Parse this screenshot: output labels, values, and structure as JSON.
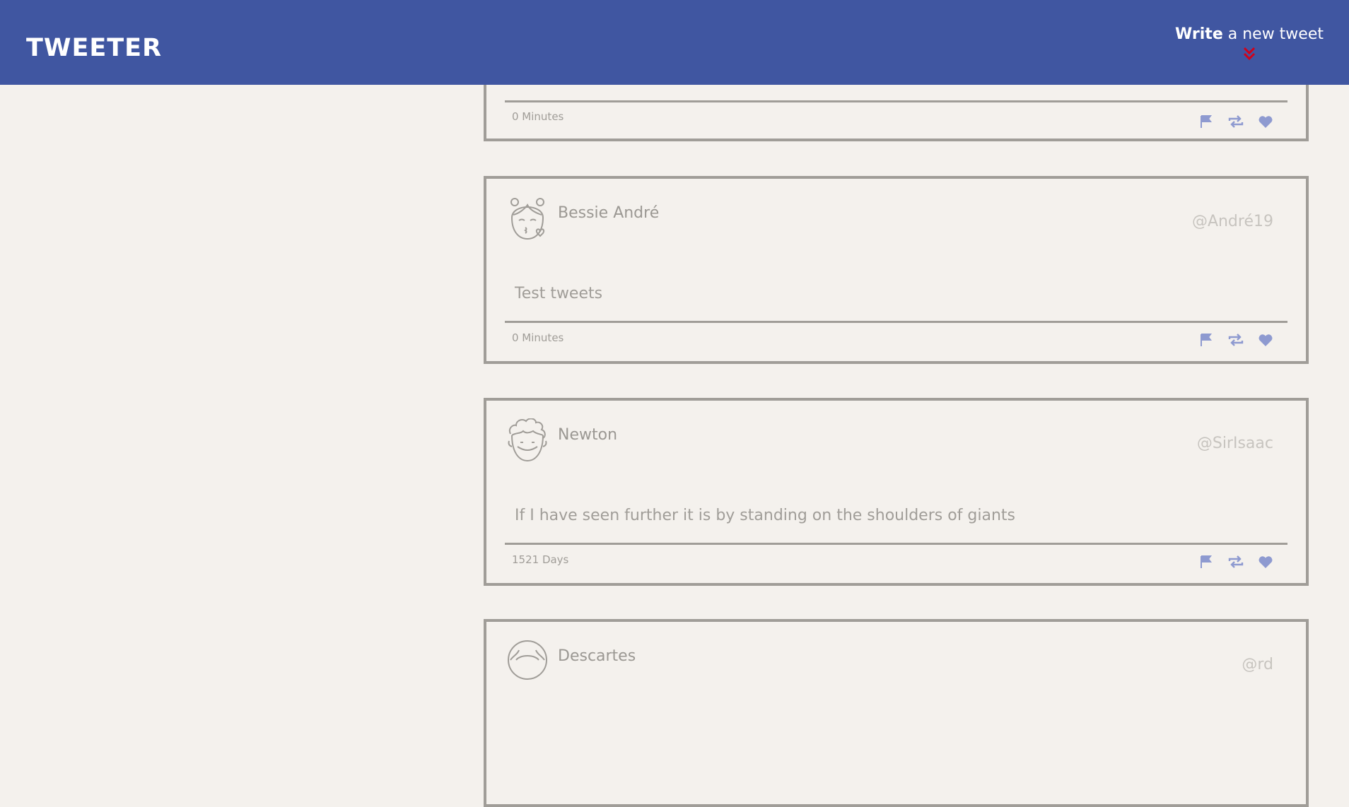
{
  "header": {
    "brand": "TWEETER",
    "compose_bold": "Write",
    "compose_rest": " a new tweet",
    "chevron_icon": "double-chevron-down-icon",
    "chevron_color": "#d0021b"
  },
  "colors": {
    "nav_bg": "#4056a1",
    "page_bg": "#f4f1ed",
    "card_border": "#a09d98",
    "action_icon": "#8e9ad0"
  },
  "tweets": [
    {
      "name": "",
      "handle": "",
      "text": "",
      "age": "0 Minutes"
    },
    {
      "name": "Bessie André",
      "handle": "@André19",
      "text": "Test tweets",
      "age": "0 Minutes",
      "avatar_icon": "girl-kiss-avatar-icon"
    },
    {
      "name": "Newton",
      "handle": "@SirIsaac",
      "text": "If I have seen further it is by standing on the shoulders of giants",
      "age": "1521 Days",
      "avatar_icon": "curly-hair-avatar-icon"
    },
    {
      "name": "Descartes",
      "handle": "@rd",
      "text": "",
      "age": "",
      "avatar_icon": "man-avatar-icon"
    }
  ],
  "actions": {
    "flag_icon": "flag-icon",
    "retweet_icon": "retweet-icon",
    "like_icon": "heart-icon"
  }
}
